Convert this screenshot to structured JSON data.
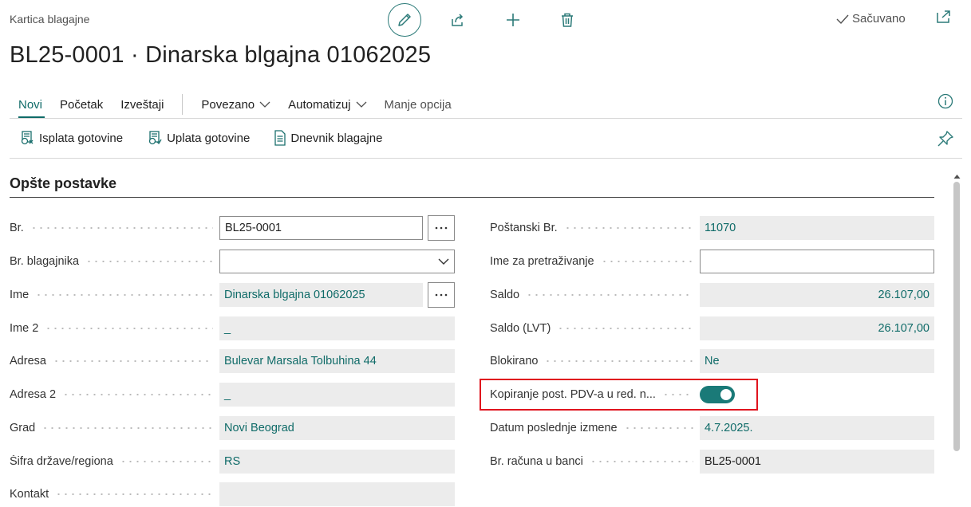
{
  "header": {
    "page_type": "Kartica blagajne",
    "title": "BL25-0001 · Dinarska blgajna 01062025",
    "saved_label": "Sačuvano",
    "icons": [
      "edit-icon",
      "share-icon",
      "add-icon",
      "delete-icon",
      "checkmark-icon",
      "open-in-new-window-icon"
    ]
  },
  "menu": {
    "items": [
      {
        "label": "Novi",
        "active": true
      },
      {
        "label": "Početak"
      },
      {
        "label": "Izveštaji"
      },
      {
        "label": "Povezano",
        "dropdown": true
      },
      {
        "label": "Automatizuj",
        "dropdown": true
      },
      {
        "label": "Manje opcija"
      }
    ]
  },
  "actions": [
    {
      "label": "Isplata gotovine",
      "icon": "payment-icon"
    },
    {
      "label": "Uplata gotovine",
      "icon": "receipt-icon"
    },
    {
      "label": "Dnevnik blagajne",
      "icon": "document-icon"
    }
  ],
  "section": {
    "title": "Opšte postavke"
  },
  "left_fields": {
    "br": {
      "label": "Br.",
      "value": "BL25-0001"
    },
    "br_blagajnika": {
      "label": "Br. blagajnika",
      "value": ""
    },
    "ime": {
      "label": "Ime",
      "value": "Dinarska blgajna 01062025"
    },
    "ime2": {
      "label": "Ime 2",
      "value": "_"
    },
    "adresa": {
      "label": "Adresa",
      "value": "Bulevar Marsala Tolbuhina 44"
    },
    "adresa2": {
      "label": "Adresa 2",
      "value": "_"
    },
    "grad": {
      "label": "Grad",
      "value": "Novi Beograd"
    },
    "sifra": {
      "label": "Šifra države/regiona",
      "value": "RS"
    },
    "kontakt": {
      "label": "Kontakt",
      "value": ""
    }
  },
  "right_fields": {
    "postanski": {
      "label": "Poštanski Br.",
      "value": "11070"
    },
    "ime_pretrazivanje": {
      "label": "Ime za pretraživanje",
      "value": ""
    },
    "saldo": {
      "label": "Saldo",
      "value": "26.107,00"
    },
    "saldo_lvt": {
      "label": "Saldo (LVT)",
      "value": "26.107,00"
    },
    "blokirano": {
      "label": "Blokirano",
      "value": "Ne"
    },
    "kopiranje": {
      "label": "Kopiranje post. PDV-a u red. n...",
      "value": true
    },
    "datum": {
      "label": "Datum poslednje izmene",
      "value": "4.7.2025."
    },
    "racun": {
      "label": "Br. računa u banci",
      "value": "BL25-0001"
    }
  },
  "colors": {
    "accent": "#0f6b68",
    "toggle_on": "#1a7a78",
    "highlight_border": "#e0141e",
    "readonly_bg": "#ececec"
  }
}
